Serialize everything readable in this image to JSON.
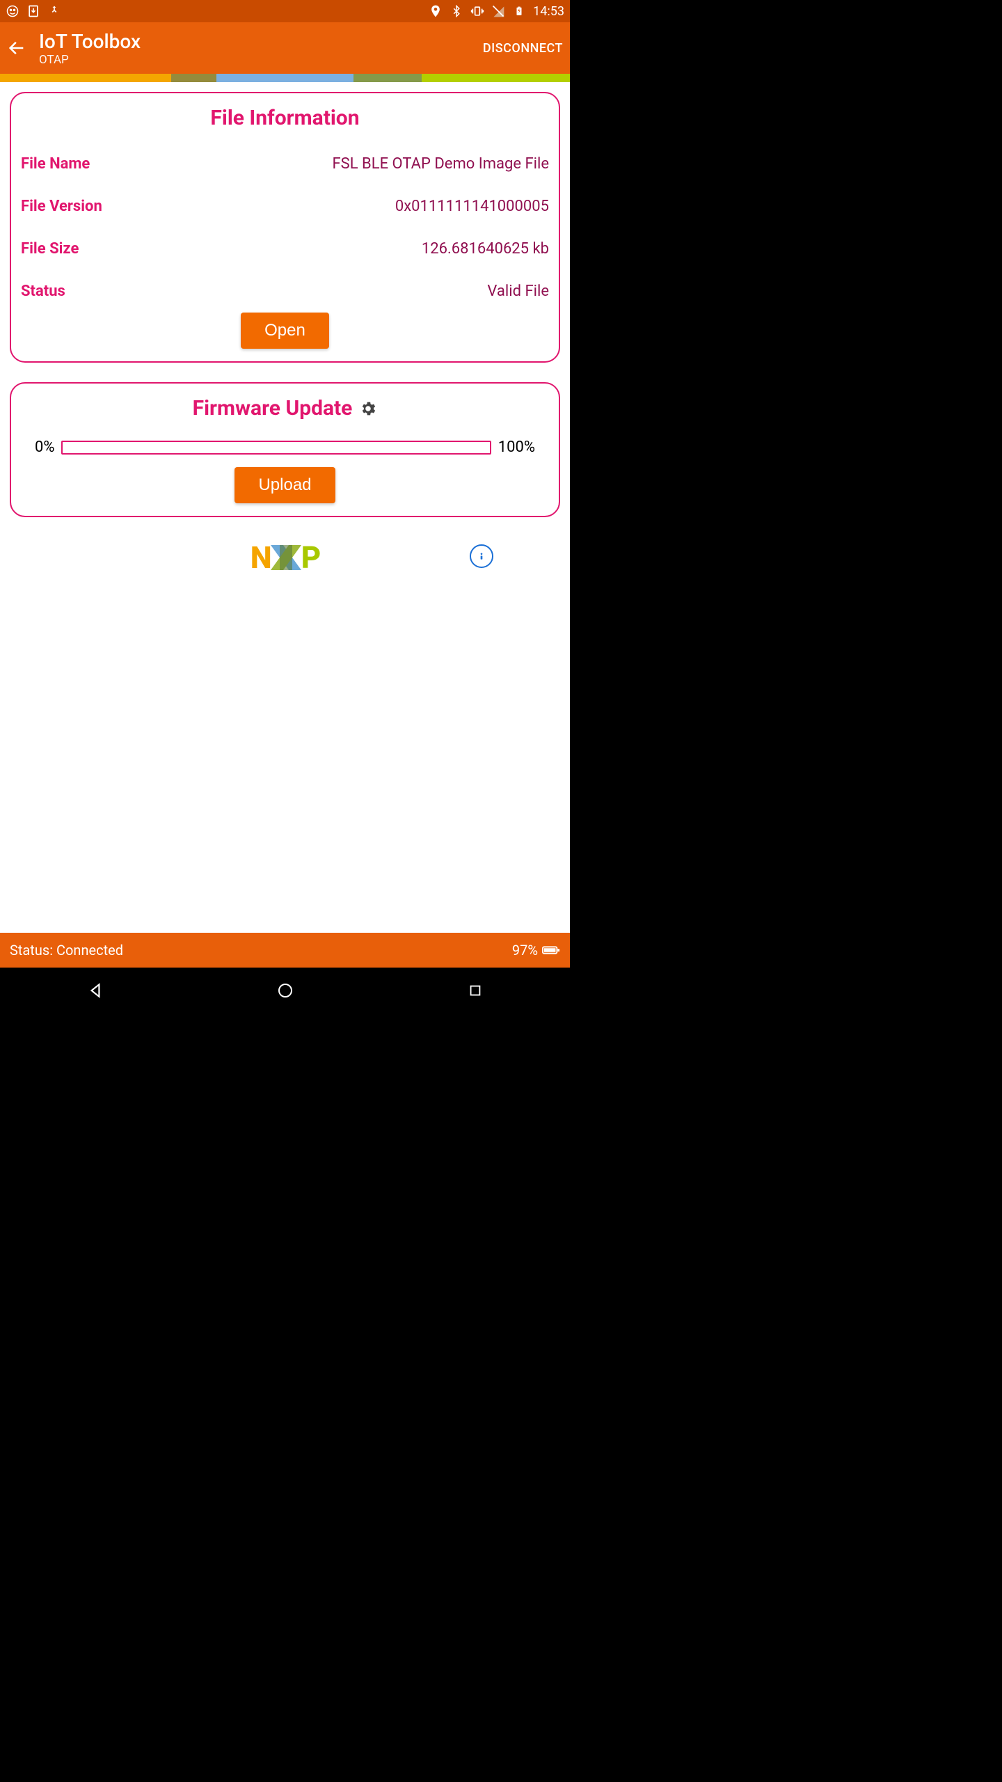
{
  "status_bar": {
    "time": "14:53"
  },
  "app_bar": {
    "title": "IoT Toolbox",
    "subtitle": "OTAP",
    "disconnect_label": "DISCONNECT"
  },
  "colors": {
    "accent": "#e85f0a",
    "brand": "#e1166e",
    "button": "#f26a00",
    "info": "#1a6fd6",
    "strip": [
      "#f4a600",
      "#948b3c",
      "#7bb0e0",
      "#859a4a",
      "#b3cf00"
    ]
  },
  "file_info": {
    "section_title": "File Information",
    "name_label": "File Name",
    "name_value": "FSL BLE OTAP Demo Image File",
    "version_label": "File Version",
    "version_value": "0x0111111141000005",
    "size_label": "File Size",
    "size_value": "126.681640625 kb",
    "status_label": "Status",
    "status_value": "Valid File",
    "open_label": "Open"
  },
  "firmware": {
    "section_title": "Firmware Update",
    "start_pct": "0%",
    "end_pct": "100%",
    "upload_label": "Upload"
  },
  "footer": {
    "status_text": "Status: Connected",
    "battery_pct": "97%"
  }
}
